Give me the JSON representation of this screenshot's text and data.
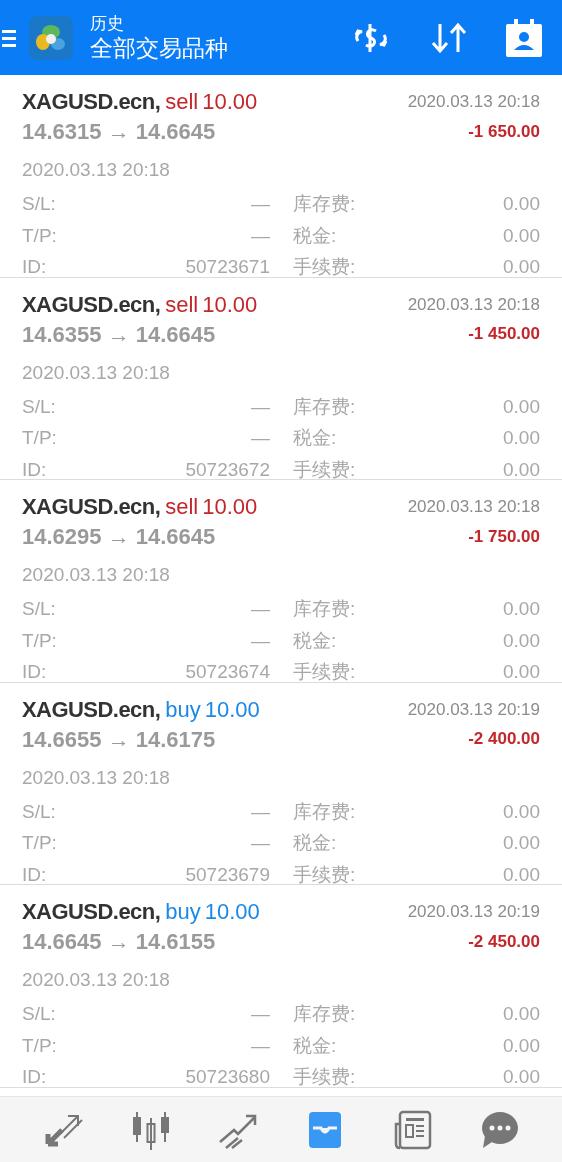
{
  "header": {
    "title": "历史",
    "subtitle": "全部交易品种"
  },
  "trades": [
    {
      "symbol": "XAGUSD.ecn,",
      "side": "sell",
      "volume": "10.00",
      "close_time": "2020.03.13 20:18",
      "prices": "14.6315 → 14.6645",
      "profit": "-1 650.00",
      "open_time": "2020.03.13 20:18",
      "fields": [
        {
          "label": "S/L:",
          "value": "—",
          "label2": "库存费:",
          "value2": "0.00"
        },
        {
          "label": "T/P:",
          "value": "—",
          "label2": "税金:",
          "value2": "0.00"
        },
        {
          "label": "ID:",
          "value": "50723671",
          "label2": "手续费:",
          "value2": "0.00"
        }
      ]
    },
    {
      "symbol": "XAGUSD.ecn,",
      "side": "sell",
      "volume": "10.00",
      "close_time": "2020.03.13 20:18",
      "prices": "14.6355 → 14.6645",
      "profit": "-1 450.00",
      "open_time": "2020.03.13 20:18",
      "fields": [
        {
          "label": "S/L:",
          "value": "—",
          "label2": "库存费:",
          "value2": "0.00"
        },
        {
          "label": "T/P:",
          "value": "—",
          "label2": "税金:",
          "value2": "0.00"
        },
        {
          "label": "ID:",
          "value": "50723672",
          "label2": "手续费:",
          "value2": "0.00"
        }
      ]
    },
    {
      "symbol": "XAGUSD.ecn,",
      "side": "sell",
      "volume": "10.00",
      "close_time": "2020.03.13 20:18",
      "prices": "14.6295 → 14.6645",
      "profit": "-1 750.00",
      "open_time": "2020.03.13 20:18",
      "fields": [
        {
          "label": "S/L:",
          "value": "—",
          "label2": "库存费:",
          "value2": "0.00"
        },
        {
          "label": "T/P:",
          "value": "—",
          "label2": "税金:",
          "value2": "0.00"
        },
        {
          "label": "ID:",
          "value": "50723674",
          "label2": "手续费:",
          "value2": "0.00"
        }
      ]
    },
    {
      "symbol": "XAGUSD.ecn,",
      "side": "buy",
      "volume": "10.00",
      "close_time": "2020.03.13 20:19",
      "prices": "14.6655 → 14.6175",
      "profit": "-2 400.00",
      "open_time": "2020.03.13 20:18",
      "fields": [
        {
          "label": "S/L:",
          "value": "—",
          "label2": "库存费:",
          "value2": "0.00"
        },
        {
          "label": "T/P:",
          "value": "—",
          "label2": "税金:",
          "value2": "0.00"
        },
        {
          "label": "ID:",
          "value": "50723679",
          "label2": "手续费:",
          "value2": "0.00"
        }
      ]
    },
    {
      "symbol": "XAGUSD.ecn,",
      "side": "buy",
      "volume": "10.00",
      "close_time": "2020.03.13 20:19",
      "prices": "14.6645 → 14.6155",
      "profit": "-2 450.00",
      "open_time": "2020.03.13 20:18",
      "fields": [
        {
          "label": "S/L:",
          "value": "—",
          "label2": "库存费:",
          "value2": "0.00"
        },
        {
          "label": "T/P:",
          "value": "—",
          "label2": "税金:",
          "value2": "0.00"
        },
        {
          "label": "ID:",
          "value": "50723680",
          "label2": "手续费:",
          "value2": "0.00"
        }
      ]
    }
  ],
  "nav": [
    {
      "kind": "quotes",
      "selected": false
    },
    {
      "kind": "chart",
      "selected": false
    },
    {
      "kind": "trade",
      "selected": false
    },
    {
      "kind": "history",
      "selected": true
    },
    {
      "kind": "news",
      "selected": false
    },
    {
      "kind": "chat",
      "selected": false
    }
  ]
}
